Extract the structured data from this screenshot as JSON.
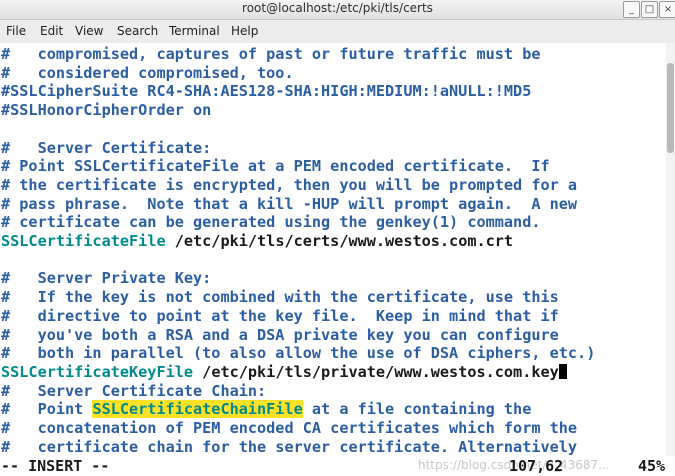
{
  "window": {
    "title": "root@localhost:/etc/pki/tls/certs",
    "buttons": {
      "minimize": "_",
      "maximize": "□",
      "close": "×"
    }
  },
  "menu": [
    "File",
    "Edit",
    "View",
    "Search",
    "Terminal",
    "Help"
  ],
  "editor": {
    "lines": [
      {
        "segments": [
          {
            "t": "#   compromised, captures of past or future traffic must be",
            "c": "comment"
          }
        ]
      },
      {
        "segments": [
          {
            "t": "#   considered compromised, too.",
            "c": "comment"
          }
        ]
      },
      {
        "segments": [
          {
            "t": "#SSLCipherSuite RC4-SHA:AES128-SHA:HIGH:MEDIUM:!aNULL:!MD5",
            "c": "comment"
          }
        ]
      },
      {
        "segments": [
          {
            "t": "#SSLHonorCipherOrder on",
            "c": "comment"
          }
        ]
      },
      {
        "segments": [
          {
            "t": "",
            "c": "comment"
          }
        ]
      },
      {
        "segments": [
          {
            "t": "#   Server Certificate:",
            "c": "comment"
          }
        ]
      },
      {
        "segments": [
          {
            "t": "# Point SSLCertificateFile at a PEM encoded certificate.  If",
            "c": "comment"
          }
        ]
      },
      {
        "segments": [
          {
            "t": "# the certificate is encrypted, then you will be prompted for a",
            "c": "comment"
          }
        ]
      },
      {
        "segments": [
          {
            "t": "# pass phrase.  Note that a kill -HUP will prompt again.  A new",
            "c": "comment"
          }
        ]
      },
      {
        "segments": [
          {
            "t": "# certificate can be generated using the genkey(1) command.",
            "c": "comment"
          }
        ]
      },
      {
        "segments": [
          {
            "t": "SSLCertificateFile",
            "c": "directive"
          },
          {
            "t": " /etc/pki/tls/certs/www.westos.com.crt",
            "c": "text"
          }
        ]
      },
      {
        "segments": [
          {
            "t": "",
            "c": "comment"
          }
        ]
      },
      {
        "segments": [
          {
            "t": "#   Server Private Key:",
            "c": "comment"
          }
        ]
      },
      {
        "segments": [
          {
            "t": "#   If the key is not combined with the certificate, use this",
            "c": "comment"
          }
        ]
      },
      {
        "segments": [
          {
            "t": "#   directive to point at the key file.  Keep in mind that if",
            "c": "comment"
          }
        ]
      },
      {
        "segments": [
          {
            "t": "#   you've both a RSA and a DSA private key you can configure",
            "c": "comment"
          }
        ]
      },
      {
        "segments": [
          {
            "t": "#   both in parallel (to also allow the use of DSA ciphers, etc.)",
            "c": "comment"
          }
        ]
      },
      {
        "segments": [
          {
            "t": "SSLCertificateKeyFile",
            "c": "directive"
          },
          {
            "t": " /etc/pki/tls/private/www.westos.com.key",
            "c": "text"
          },
          {
            "t": "",
            "c": "cursor"
          }
        ]
      },
      {
        "segments": [
          {
            "t": "#   Server Certificate Chain:",
            "c": "comment"
          }
        ]
      },
      {
        "segments": [
          {
            "t": "#   Point ",
            "c": "comment"
          },
          {
            "t": "SSLCertificateChainFile",
            "c": "search"
          },
          {
            "t": " at a file containing the",
            "c": "comment"
          }
        ]
      },
      {
        "segments": [
          {
            "t": "#   concatenation of PEM encoded CA certificates which form the",
            "c": "comment"
          }
        ]
      },
      {
        "segments": [
          {
            "t": "#   certificate chain for the server certificate. Alternatively",
            "c": "comment"
          }
        ]
      }
    ]
  },
  "status": {
    "mode": "-- INSERT --",
    "position": "107,62",
    "percent": "45%",
    "watermark": "https://blog.csdn.net/u_43687..."
  },
  "colors": {
    "comment": "#2b5ea3",
    "directive": "#008b8b",
    "text": "#1a1a1a",
    "search_highlight": "#ffe227"
  }
}
